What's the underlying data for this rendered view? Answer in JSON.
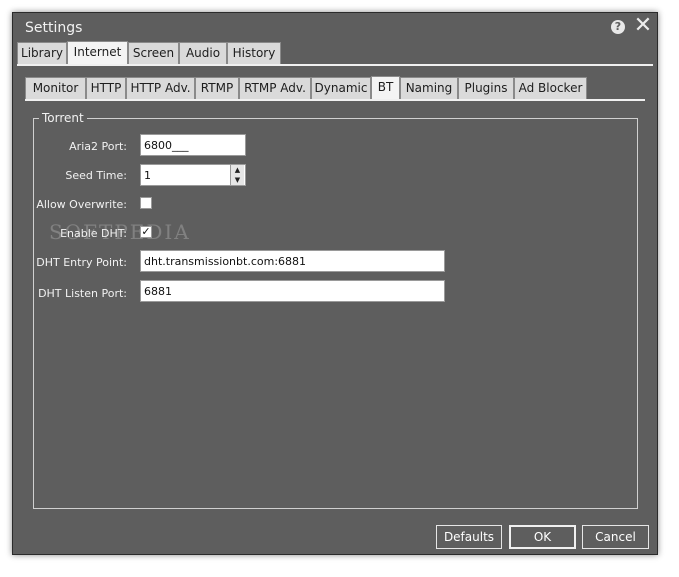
{
  "window": {
    "title": "Settings"
  },
  "main_tabs": [
    "Library",
    "Internet",
    "Screen",
    "Audio",
    "History"
  ],
  "main_tab_active": "Internet",
  "sub_tabs": [
    "Monitor",
    "HTTP",
    "HTTP Adv.",
    "RTMP",
    "RTMP Adv.",
    "Dynamic",
    "BT",
    "Naming",
    "Plugins",
    "Ad Blocker"
  ],
  "sub_tab_active": "BT",
  "torrent": {
    "group_label": "Torrent",
    "aria2_port_label": "Aria2 Port:",
    "aria2_port_value": "6800___",
    "seed_time_label": "Seed Time:",
    "seed_time_value": "1",
    "allow_overwrite_label": "Allow Overwrite:",
    "allow_overwrite_checked": false,
    "enable_dht_label": "Enable DHT:",
    "enable_dht_checked": true,
    "dht_entry_point_label": "DHT Entry Point:",
    "dht_entry_point_value": "dht.transmissionbt.com:6881",
    "dht_listen_port_label": "DHT Listen Port:",
    "dht_listen_port_value": "6881"
  },
  "watermark": "SOFTPEDIA",
  "buttons": {
    "defaults": "Defaults",
    "ok": "OK",
    "cancel": "Cancel"
  },
  "icons": {
    "help": "help-icon",
    "close": "close-icon",
    "checkmark": "checkmark-icon",
    "spin_up": "spin-up-icon",
    "spin_down": "spin-down-icon"
  },
  "colors": {
    "window_bg": "#5e5e5e",
    "tab_bg": "#dadada",
    "tab_active_bg": "#f4f4f4"
  }
}
